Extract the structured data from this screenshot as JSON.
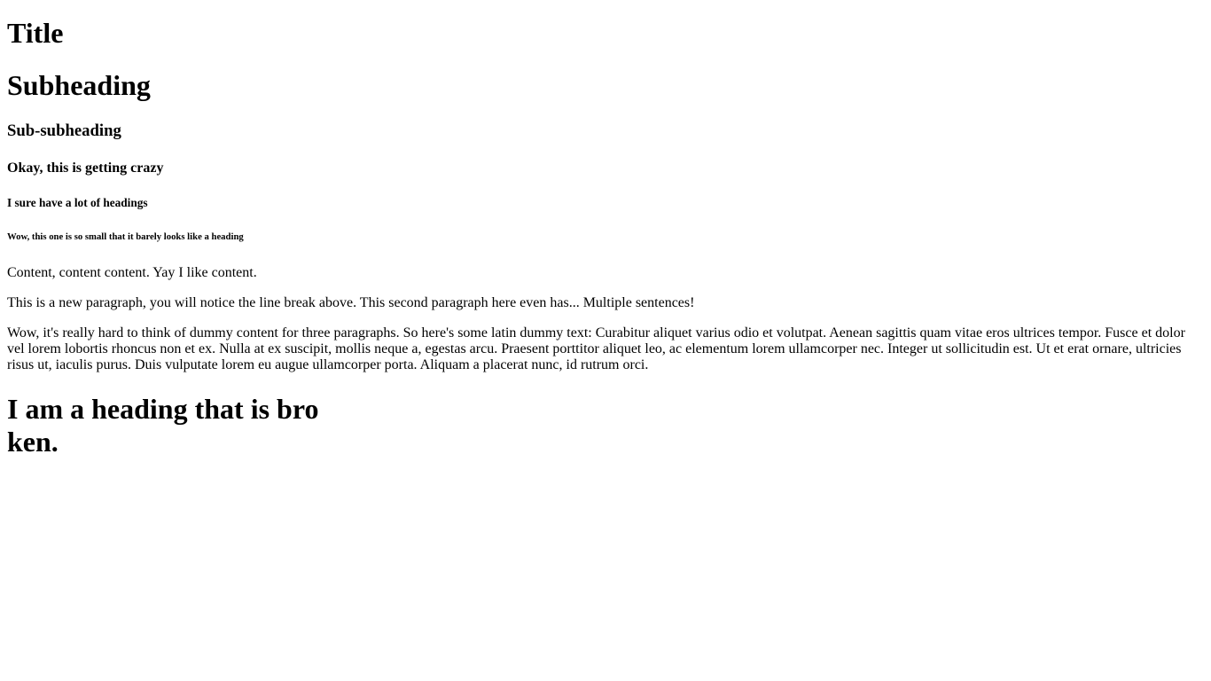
{
  "headings": {
    "title": "Title",
    "subheading": "Subheading",
    "sub_subheading": "Sub-subheading",
    "crazy": "Okay, this is getting crazy",
    "lots": "I sure have a lot of headings",
    "tiny": "Wow, this one is so small that it barely looks like a heading"
  },
  "paragraphs": [
    "Content, content content. Yay I like content.",
    "This is a new paragraph, you will notice the line break above. This second paragraph here even has... Multiple sentences!",
    "Wow, it's really hard to think of dummy content for three paragraphs. So here's some latin dummy text: Curabitur aliquet varius odio et volutpat. Aenean sagittis quam vitae eros ultrices tempor. Fusce et dolor vel lorem lobortis rhoncus non et ex. Nulla at ex suscipit, mollis neque a, egestas arcu. Praesent porttitor aliquet leo, ac elementum lorem ullamcorper nec. Integer ut sollicitudin est. Ut et erat ornare, ultricies risus ut, iaculis purus. Duis vulputate lorem eu augue ullamcorper porta. Aliquam a placerat nunc, id rutrum orci."
  ],
  "broken_heading": "I am a heading that is broken."
}
